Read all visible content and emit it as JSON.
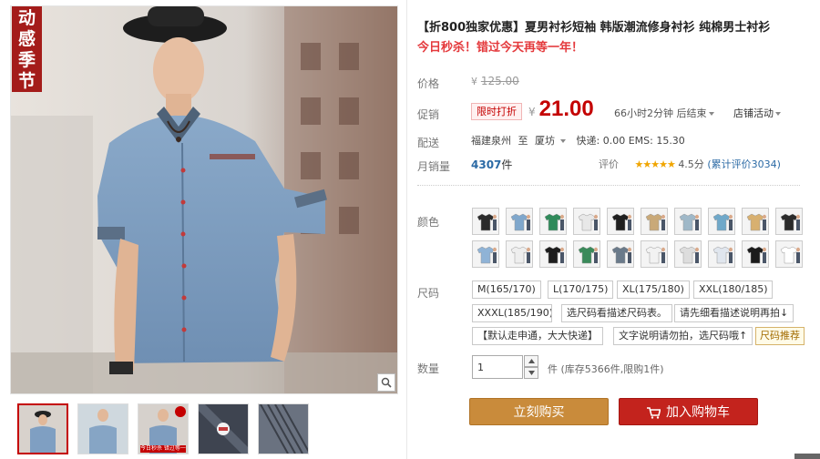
{
  "gallery": {
    "promo_tag_lines": [
      "动感",
      "季节"
    ],
    "zoom_icon": "magnifier-icon",
    "thumb_badge_text": "今日秒杀 错过等一年"
  },
  "product": {
    "title": "【折800独家优惠】夏男衬衫短袖 韩版潮流修身衬衫 纯棉男士衬衫",
    "subtitle": "今日秒杀！错过今天再等一年！"
  },
  "price": {
    "label": "价格",
    "currency": "¥",
    "original": "125.00"
  },
  "promo": {
    "label": "促销",
    "badge": "限时打折",
    "currency": "¥",
    "price": "21.00",
    "countdown": "66小时2分钟 后结束",
    "store_promo": "店铺活动"
  },
  "shipping": {
    "label": "配送",
    "from": "福建泉州",
    "to_word": "至",
    "to": "厦坊",
    "fees": "快递: 0.00 EMS: 15.30"
  },
  "sales": {
    "label": "月销量",
    "count": "4307",
    "unit": "件",
    "rating_label": "评价",
    "stars": "★★★★★",
    "score": "4.5分",
    "reviews_link": "(累计评价3034)"
  },
  "colors": {
    "label": "颜色",
    "swatch_count": 20
  },
  "sizes": {
    "label": "尺码",
    "options": [
      "M(165/170)",
      "L(170/175)",
      "XL(175/180)",
      "XXL(180/185)",
      "XXXL(185/190)",
      "选尺码看描述尺码表。",
      "请先细看描述说明再拍↓",
      "【默认走申通，大大快递】",
      "文字说明请勿拍，选尺码哦↑"
    ],
    "tip": "尺码推荐"
  },
  "quantity": {
    "label": "数量",
    "value": "1",
    "unit": "件",
    "stock": "(库存5366件,限购1件)"
  },
  "actions": {
    "buy_now": "立刻购买",
    "add_to_cart": "加入购物车"
  },
  "colors_palette": {
    "brand_red": "#c40000",
    "buy_orange": "#c98b3b",
    "cart_red": "#c3231d",
    "link_blue": "#2b6aa5"
  }
}
